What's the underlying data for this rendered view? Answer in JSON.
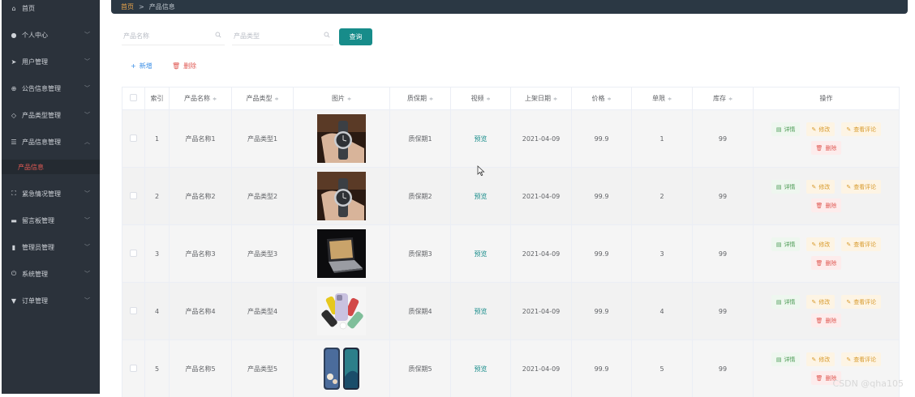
{
  "sidebar": {
    "items": [
      {
        "label": "首页",
        "icon": "home-icon",
        "glyph": "⌂",
        "top": 0
      },
      {
        "label": "个人中心",
        "icon": "user-icon",
        "glyph": "●",
        "chev": "﹀"
      },
      {
        "label": "用户管理",
        "icon": "send-icon",
        "glyph": "➤",
        "chev": "﹀"
      },
      {
        "label": "公告信息管理",
        "icon": "plus-circle-icon",
        "glyph": "⊕",
        "chev": "﹀"
      },
      {
        "label": "产品类型管理",
        "icon": "layers-icon",
        "glyph": "◇",
        "chev": "﹀"
      },
      {
        "label": "产品信息管理",
        "icon": "list-icon",
        "glyph": "☰",
        "chev": "︿"
      },
      {
        "label": "紧急情况管理",
        "icon": "scan-icon",
        "glyph": "⛶",
        "chev": "﹀"
      },
      {
        "label": "留言板管理",
        "icon": "message-icon",
        "glyph": "▬",
        "chev": "﹀"
      },
      {
        "label": "管理员管理",
        "icon": "bar-chart-icon",
        "glyph": "▮",
        "chev": "﹀"
      },
      {
        "label": "系统管理",
        "icon": "power-icon",
        "glyph": "⏻",
        "chev": "﹀"
      },
      {
        "label": "订单管理",
        "icon": "bookmark-icon",
        "glyph": "▼",
        "chev": "﹀"
      }
    ],
    "active_sub": "产品信息"
  },
  "breadcrumb": {
    "home": "首页",
    "sep": ">",
    "current": "产品信息"
  },
  "search": {
    "name_placeholder": "产品名称",
    "type_placeholder": "产品类型",
    "query_label": "查询"
  },
  "actions": {
    "add_label": "新增",
    "delete_label": "删除"
  },
  "table": {
    "headers": [
      "索引",
      "产品名称",
      "产品类型",
      "图片",
      "质保期",
      "视频",
      "上架日期",
      "价格",
      "单限",
      "库存",
      "操作"
    ],
    "rows": [
      {
        "index": "1",
        "name": "产品名称1",
        "type": "产品类型1",
        "image": "watch",
        "warranty": "质保期1",
        "video": "预览",
        "date": "2021-04-09",
        "price": "99.9",
        "limit": "1",
        "stock": "99"
      },
      {
        "index": "2",
        "name": "产品名称2",
        "type": "产品类型2",
        "image": "watch",
        "warranty": "质保期2",
        "video": "预览",
        "date": "2021-04-09",
        "price": "99.9",
        "limit": "2",
        "stock": "99"
      },
      {
        "index": "3",
        "name": "产品名称3",
        "type": "产品类型3",
        "image": "laptop",
        "warranty": "质保期3",
        "video": "预览",
        "date": "2021-04-09",
        "price": "99.9",
        "limit": "3",
        "stock": "99"
      },
      {
        "index": "4",
        "name": "产品名称4",
        "type": "产品类型4",
        "image": "phones",
        "warranty": "质保期4",
        "video": "预览",
        "date": "2021-04-09",
        "price": "99.9",
        "limit": "4",
        "stock": "99"
      },
      {
        "index": "5",
        "name": "产品名称5",
        "type": "产品类型5",
        "image": "phone-pair",
        "warranty": "质保期5",
        "video": "预览",
        "date": "2021-04-09",
        "price": "99.9",
        "limit": "5",
        "stock": "99"
      }
    ],
    "ops": {
      "detail": "详情",
      "edit": "修改",
      "comment": "查看评论",
      "delete": "删除"
    }
  },
  "watermark": "CSDN @qha105",
  "colors": {
    "sidebar": "#2b323b",
    "accent": "#178c8a",
    "danger": "#e05a54",
    "warning": "#d89a2c",
    "success": "#4a9a52"
  }
}
